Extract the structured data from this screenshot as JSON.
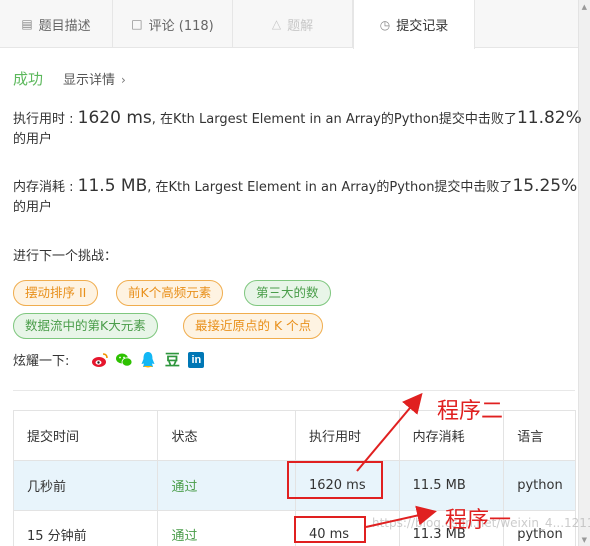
{
  "tabs": [
    {
      "label": "题目描述",
      "icon": "document-icon"
    },
    {
      "label": "评论 (118)",
      "icon": "comment-icon"
    },
    {
      "label": "题解",
      "icon": "flask-icon"
    },
    {
      "label": "提交记录",
      "icon": "clock-icon"
    }
  ],
  "status": {
    "result": "成功",
    "detail_link": "显示详情"
  },
  "runtime": {
    "label": "执行用时 : ",
    "value": "1620 ms",
    "middle": ", 在Kth Largest Element in an Array的Python提交中击败了",
    "percent": "11.82%",
    "suffix": "的用户"
  },
  "memory": {
    "label": "内存消耗 : ",
    "value": "11.5 MB",
    "middle": ", 在Kth Largest Element in an Array的Python提交中击败了",
    "percent": "15.25%",
    "suffix": "的用户"
  },
  "next_challenge": {
    "title": "进行下一个挑战：",
    "tags": [
      {
        "label": "摆动排序 II",
        "color": "orange"
      },
      {
        "label": "前K个高频元素",
        "color": "orange"
      },
      {
        "label": "第三大的数",
        "color": "green"
      },
      {
        "label": "数据流中的第K大元素",
        "color": "green"
      },
      {
        "label": "最接近原点的 K 个点",
        "color": "orange"
      }
    ]
  },
  "share": {
    "label": "炫耀一下:",
    "icons": [
      "weibo-icon",
      "wechat-icon",
      "qq-icon",
      "douban-icon",
      "linkedin-icon"
    ],
    "douban_glyph": "豆",
    "linkedin_glyph": "in"
  },
  "table": {
    "headers": [
      "提交时间",
      "状态",
      "执行用时",
      "内存消耗",
      "语言"
    ],
    "rows": [
      {
        "time": "几秒前",
        "status": "通过",
        "runtime": "1620 ms",
        "memory": "11.5 MB",
        "language": "python"
      },
      {
        "time": "15 分钟前",
        "status": "通过",
        "runtime": "40 ms",
        "memory": "11.3 MB",
        "language": "python"
      }
    ]
  },
  "annotations": {
    "label_1": "程序二",
    "label_2": "程序一"
  },
  "watermark": "https://blog.csdn.net/weixin_4...1211",
  "colors": {
    "success": "#5cb85c",
    "annotation": "#e02020",
    "tag_orange": "#e8901c",
    "tag_green": "#4a9d4a"
  }
}
